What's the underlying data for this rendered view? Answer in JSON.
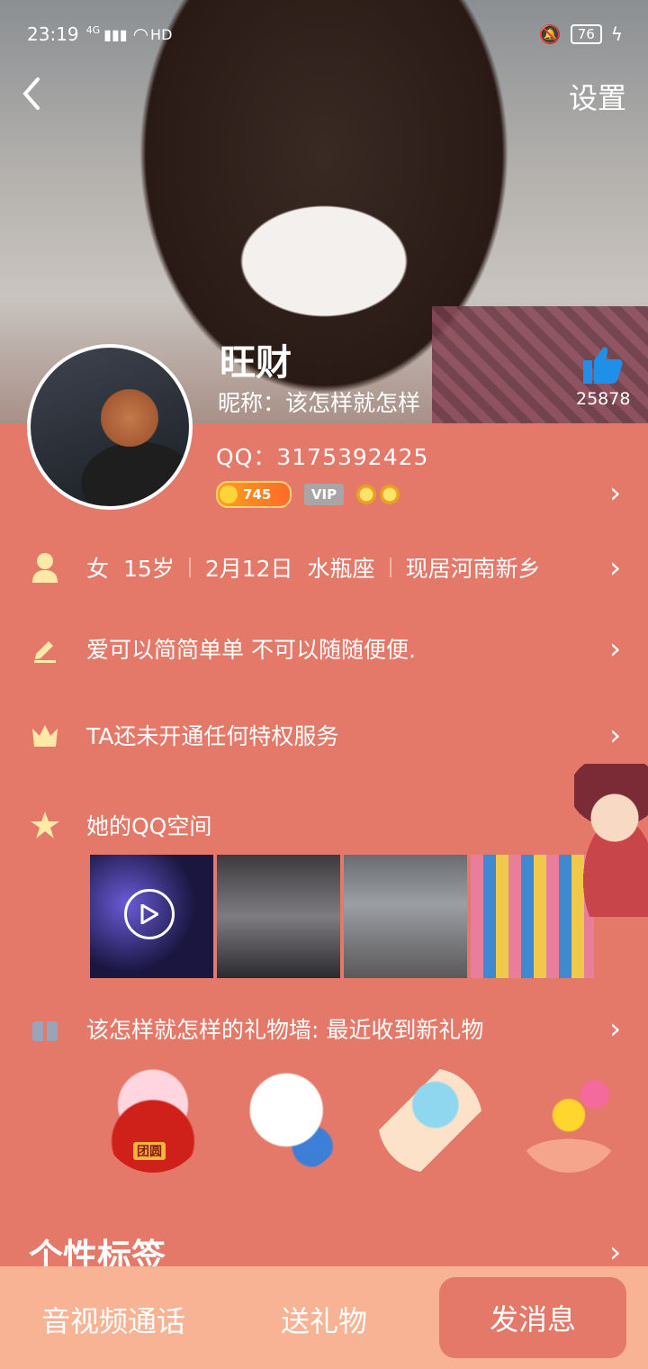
{
  "status_bar": {
    "time": "23:19",
    "network": "4G",
    "hd": "HD",
    "battery": "76"
  },
  "nav": {
    "settings_label": "设置"
  },
  "profile": {
    "name": "旺财",
    "nickname": "昵称：该怎样就怎样",
    "qq": "QQ：3175392425",
    "likes": "25878",
    "coin_level": "745",
    "vip_label": "VIP"
  },
  "info": {
    "gender": "女",
    "age": "15岁",
    "birthday": "2月12日",
    "zodiac": "水瓶座",
    "location": "现居河南新乡",
    "signature": "爱可以简简单单 不可以随随便便.",
    "privilege": "TA还未开通任何特权服务",
    "qzone_title": "她的QQ空间",
    "gift_wall": "该怎样就怎样的礼物墙: 最近收到新礼物"
  },
  "tags_title": "个性标签",
  "gift_texts": {
    "g1": "团圆"
  },
  "bottom_bar": {
    "call_label": "音视频通话",
    "gift_label": "送礼物",
    "message_label": "发消息"
  },
  "colors": {
    "background": "#e4796a",
    "bottom_bar": "#f7b394",
    "primary_button": "#e4796a"
  }
}
